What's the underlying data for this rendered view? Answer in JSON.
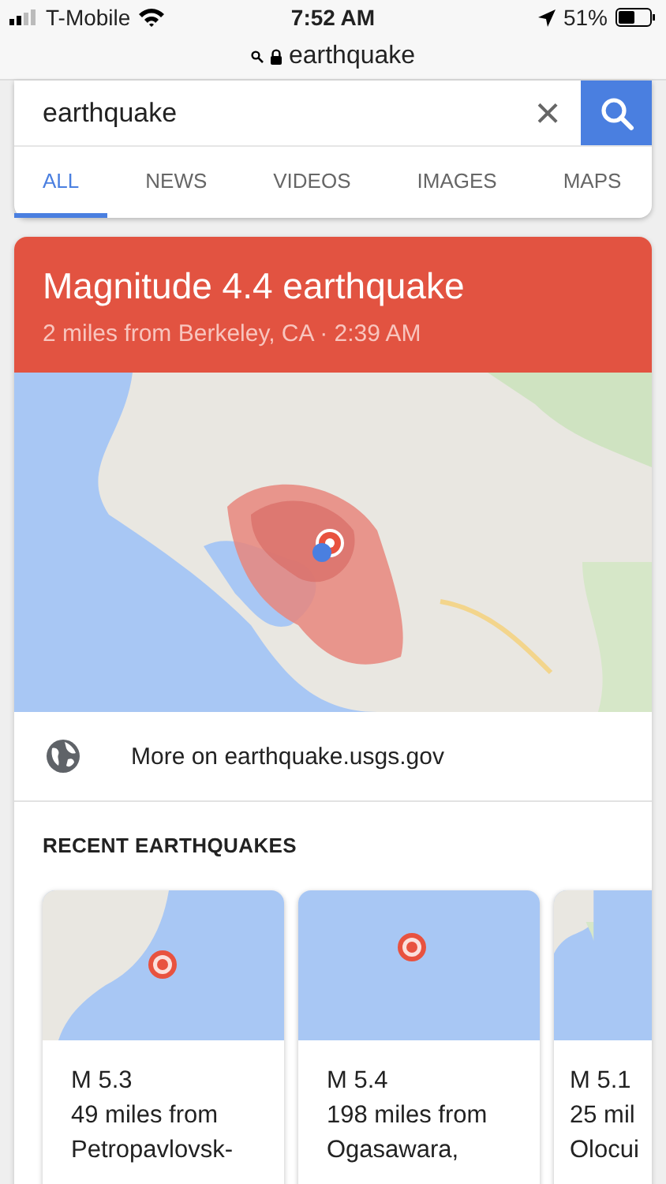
{
  "status_bar": {
    "carrier": "T-Mobile",
    "time": "7:52 AM",
    "battery": "51%"
  },
  "address_bar": {
    "url": "earthquake"
  },
  "search": {
    "value": "earthquake",
    "clear": "×"
  },
  "tabs": [
    {
      "label": "ALL",
      "selected": true
    },
    {
      "label": "NEWS",
      "selected": false
    },
    {
      "label": "VIDEOS",
      "selected": false
    },
    {
      "label": "IMAGES",
      "selected": false
    },
    {
      "label": "MAPS",
      "selected": false
    }
  ],
  "result": {
    "title": "Magnitude 4.4 earthquake",
    "subtitle": "2 miles from Berkeley, CA · 2:39 AM",
    "map": {
      "kind": "picture"
    },
    "link": "More on earthquake.usgs.gov"
  },
  "recent": {
    "heading": "RECENT EARTHQUAKES",
    "cards": [
      {
        "map": {
          "kind": "picture"
        },
        "magnitude": "M 5.3",
        "lines": [
          "49 miles from",
          "Petropavlovsk-"
        ]
      },
      {
        "map": {
          "kind": "picture"
        },
        "magnitude": "M 5.4",
        "lines": [
          "198 miles from",
          "Ogasawara,"
        ]
      },
      {
        "map": {
          "kind": "picture"
        },
        "magnitude": "M 5.1",
        "lines": [
          "25 mil",
          "Olocui"
        ]
      }
    ]
  }
}
